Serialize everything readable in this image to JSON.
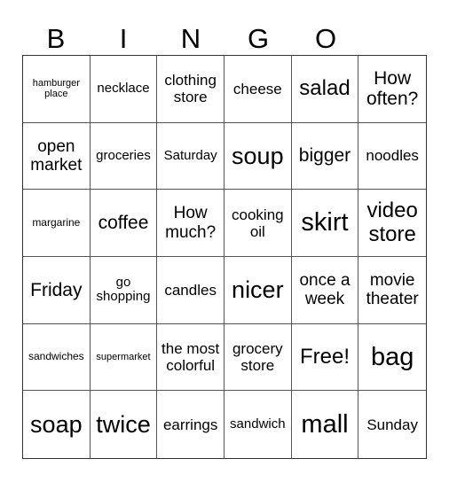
{
  "header": [
    "B",
    "I",
    "N",
    "G",
    "O"
  ],
  "cells": [
    [
      "hamburger place",
      "necklace",
      "clothing store",
      "cheese",
      "salad",
      "How often?"
    ],
    [
      "open market",
      "groceries",
      "Saturday",
      "soup",
      "bigger",
      "noodles"
    ],
    [
      "margarine",
      "coffee",
      "How much?",
      "cooking oil",
      "skirt",
      "video store"
    ],
    [
      "Friday",
      "go shopping",
      "candles",
      "nicer",
      "once a week",
      "movie theater"
    ],
    [
      "sandwiches",
      "supermarket",
      "the most colorful",
      "grocery store",
      "Free!",
      "bag"
    ],
    [
      "soap",
      "twice",
      "earrings",
      "sandwich",
      "mall",
      "Sunday"
    ]
  ]
}
